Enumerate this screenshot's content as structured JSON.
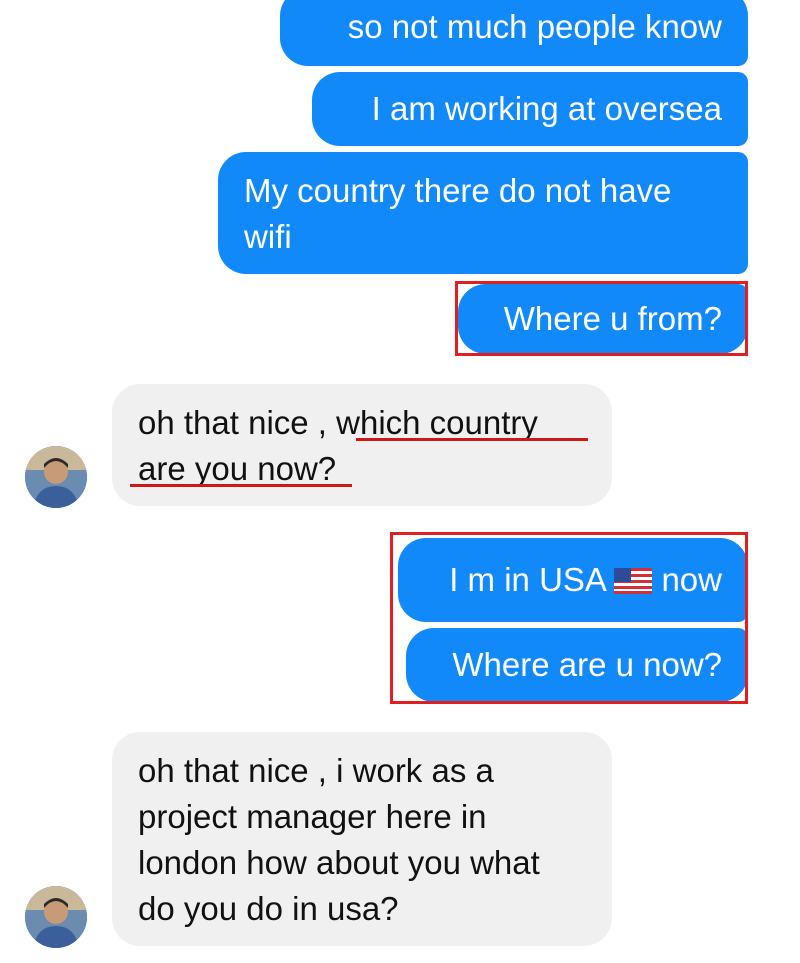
{
  "messages": [
    {
      "side": "sent",
      "lines": [
        "so not much people know"
      ]
    },
    {
      "side": "sent",
      "lines": [
        "I am working at oversea"
      ]
    },
    {
      "side": "sent",
      "lines": [
        "My country there do not have",
        "wifi"
      ]
    },
    {
      "side": "sent",
      "lines": [
        "Where u from?"
      ]
    },
    {
      "side": "received",
      "lines": [
        "oh that nice , which country",
        "are you now?"
      ]
    },
    {
      "side": "sent",
      "text_before_flag": "I m in USA",
      "flag_icon": "us-flag-icon",
      "text_after_flag": "now"
    },
    {
      "side": "sent",
      "lines": [
        "Where are u now?"
      ]
    },
    {
      "side": "received",
      "lines": [
        "oh that nice , i work as a",
        "project manager here in",
        "london how about you what",
        "do you do in usa?"
      ]
    }
  ],
  "colors": {
    "sent_bubble": "#1289f8",
    "received_bubble": "#f1f0f0",
    "highlight": "#e02020"
  }
}
